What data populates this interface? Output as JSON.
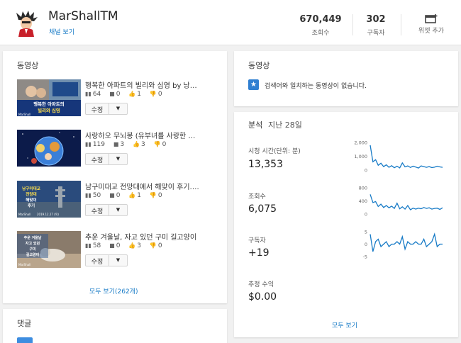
{
  "channel": {
    "name": "MarShallTM",
    "view_channel": "채널 보기",
    "stats": [
      {
        "value": "670,449",
        "label": "조회수"
      },
      {
        "value": "302",
        "label": "구독자"
      }
    ],
    "add_widget_label": "위젯 추가"
  },
  "videos": {
    "title": "동영상",
    "items": [
      {
        "title": "행복한 아파트의 빌리와 심영 by 낭…",
        "views": "64",
        "comments": "0",
        "likes": "1",
        "dislikes": "0",
        "edit_label": "수정",
        "thumb_text": "행복한 아파트의 빌리와 심영",
        "thumb_corner": "MarShall"
      },
      {
        "title": "사랑하오 무뇌봉 (유부녀를 사랑한 …",
        "views": "119",
        "comments": "3",
        "likes": "3",
        "dislikes": "0",
        "edit_label": "수정",
        "thumb_text": "",
        "thumb_corner": ""
      },
      {
        "title": "남구미대교 전망대에서 해맞이 후기….",
        "views": "50",
        "comments": "0",
        "likes": "1",
        "dislikes": "0",
        "edit_label": "수정",
        "thumb_text": "남구미대교 전망대 해맞이 후기",
        "thumb_corner": "MarShall",
        "thumb_date": "2019.12.27 (목)"
      },
      {
        "title": "추운 겨울날, 자고 있던 구미 길고양이",
        "views": "58",
        "comments": "0",
        "likes": "3",
        "dislikes": "0",
        "edit_label": "수정",
        "thumb_text": "추운 겨울날 자고 있던 구미 길고양이",
        "thumb_corner": "MarShall"
      }
    ],
    "see_all": "모두 보기(262개)"
  },
  "comments": {
    "title": "댓글"
  },
  "search_videos": {
    "title": "동영상",
    "empty_message": "검색어와 일치하는 동영상이 없습니다."
  },
  "analytics": {
    "title": "분석",
    "period": "지난 28일",
    "see_all": "모두 보기",
    "metrics": [
      {
        "label": "시청 시간(단위: 분)",
        "value": "13,353"
      },
      {
        "label": "조회수",
        "value": "6,075"
      },
      {
        "label": "구독자",
        "value": "+19"
      },
      {
        "label": "추정 수익",
        "value": "$0.00"
      }
    ],
    "line_color": "#167ac6"
  },
  "chart_data": [
    {
      "type": "line",
      "title": "시청 시간(단위: 분)",
      "ylim": [
        0,
        2000
      ],
      "yticks": [
        "2,000",
        "1,000",
        "0"
      ],
      "values": [
        1800,
        600,
        750,
        350,
        500,
        250,
        380,
        200,
        320,
        170,
        280,
        160,
        520,
        230,
        300,
        190,
        280,
        220,
        150,
        300,
        250,
        200,
        250,
        180,
        210,
        280,
        230,
        200
      ]
    },
    {
      "type": "line",
      "title": "조회수",
      "ylim": [
        0,
        800
      ],
      "yticks": [
        "800",
        "400",
        "0"
      ],
      "values": [
        600,
        350,
        380,
        230,
        300,
        200,
        260,
        190,
        240,
        170,
        330,
        160,
        220,
        150,
        260,
        130,
        180,
        150,
        180,
        160,
        200,
        170,
        190,
        150,
        170,
        180,
        140,
        190
      ]
    },
    {
      "type": "line",
      "title": "구독자",
      "ylim": [
        -5,
        5
      ],
      "yticks": [
        "5",
        "0",
        "-5"
      ],
      "values": [
        4,
        -3,
        1,
        2,
        -1,
        0,
        1,
        -1,
        0,
        0,
        1,
        0,
        3,
        -2,
        1,
        0,
        0,
        1,
        0,
        0,
        2,
        -1,
        0,
        1,
        4,
        -1,
        0,
        0
      ]
    }
  ]
}
